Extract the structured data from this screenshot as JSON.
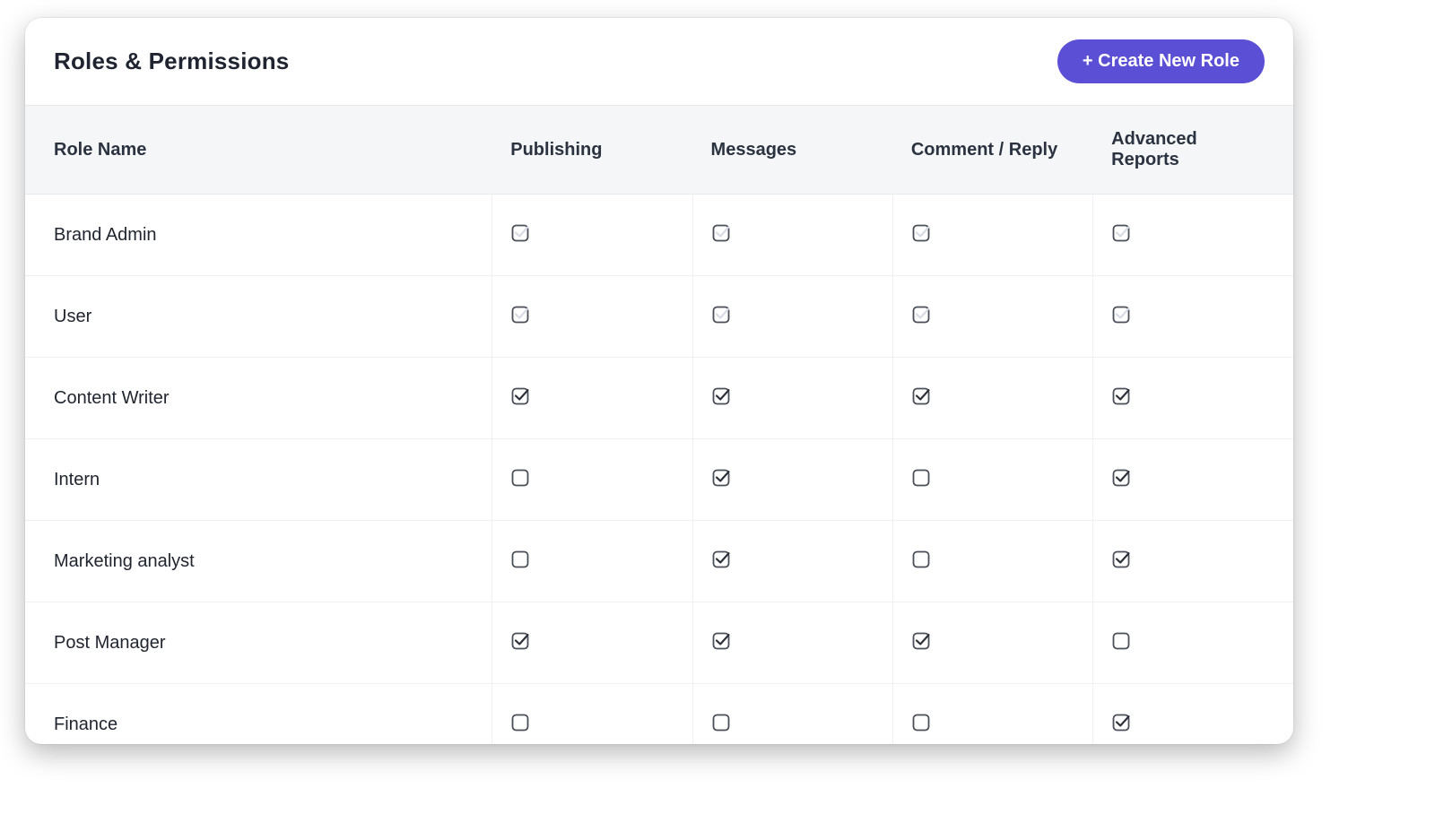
{
  "header": {
    "title": "Roles & Permissions",
    "create_button_label": "+ Create New Role"
  },
  "columns": {
    "name": "Role Name",
    "perm0": "Publishing",
    "perm1": "Messages",
    "perm2": "Comment / Reply",
    "perm3": "Advanced Reports"
  },
  "roles": [
    {
      "name": "Brand Admin",
      "perms": [
        "locked-checked",
        "locked-checked",
        "locked-checked",
        "locked-checked"
      ]
    },
    {
      "name": "User",
      "perms": [
        "locked-checked",
        "locked-checked",
        "locked-checked",
        "locked-checked"
      ]
    },
    {
      "name": "Content Writer",
      "perms": [
        "checked",
        "checked",
        "checked",
        "checked"
      ]
    },
    {
      "name": "Intern",
      "perms": [
        "empty",
        "checked",
        "empty",
        "checked"
      ]
    },
    {
      "name": "Marketing analyst",
      "perms": [
        "empty",
        "checked",
        "empty",
        "checked"
      ]
    },
    {
      "name": "Post Manager",
      "perms": [
        "checked",
        "checked",
        "checked",
        "empty"
      ]
    },
    {
      "name": "Finance",
      "perms": [
        "empty",
        "empty",
        "empty",
        "checked"
      ]
    }
  ]
}
